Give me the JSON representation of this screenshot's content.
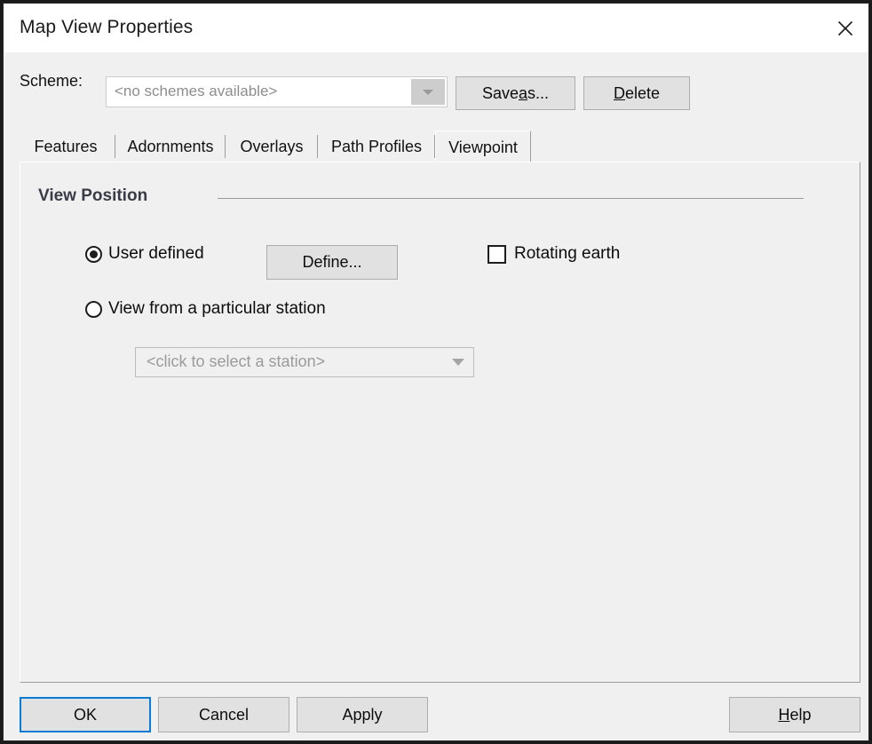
{
  "window": {
    "title": "Map View Properties",
    "close_icon": "close-icon"
  },
  "scheme": {
    "label": "Scheme:",
    "value": "<no schemes available>",
    "dropdown_icon": "chevron-down-icon",
    "save_as_label": "Save ",
    "save_as_accel": "a",
    "save_as_tail": "s...",
    "delete_accel": "D",
    "delete_tail": "elete"
  },
  "tabs": [
    {
      "label": "Features",
      "active": false
    },
    {
      "label": "Adornments",
      "active": false
    },
    {
      "label": "Overlays",
      "active": false
    },
    {
      "label": "Path Profiles",
      "active": false
    },
    {
      "label": "Viewpoint",
      "active": true
    }
  ],
  "viewpoint": {
    "group_title": "View Position",
    "user_defined": {
      "label": "User defined",
      "selected": true
    },
    "define_button": "Define...",
    "rotating_earth": {
      "label": "Rotating earth",
      "checked": false
    },
    "view_from_station": {
      "label": "View from a particular station",
      "selected": false
    },
    "station_combo": {
      "value": "<click to select a station>",
      "placeholder": "<click to select a station>",
      "dropdown_icon": "chevron-down-icon",
      "enabled": false
    }
  },
  "footer": {
    "ok_label": "OK",
    "cancel_label": "Cancel",
    "apply_label": "Apply",
    "help_accel": "H",
    "help_tail": "elp"
  },
  "colors": {
    "focus_blue": "#0a7cd6",
    "dialog_bg": "#f0f0f0",
    "titlebar_bg": "#ffffff",
    "button_bg": "#e1e1e1",
    "group_title": "#3b3b47",
    "disabled_text": "#9b9b9b"
  }
}
